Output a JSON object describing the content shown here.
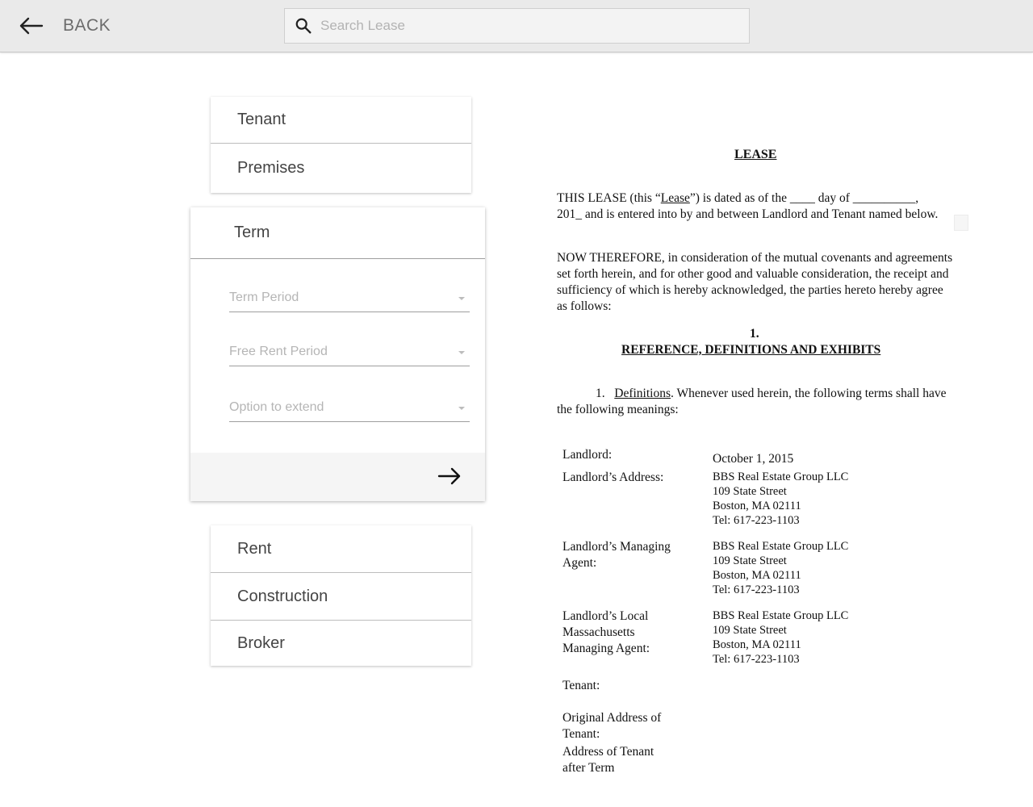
{
  "header": {
    "back_label": "BACK",
    "search_placeholder": "Search Lease"
  },
  "sidebar": {
    "top_items": [
      {
        "label": "Tenant"
      },
      {
        "label": "Premises"
      }
    ],
    "term": {
      "label": "Term",
      "fields": [
        {
          "placeholder": "Term Period"
        },
        {
          "placeholder": "Free Rent Period"
        },
        {
          "placeholder": "Option to extend"
        }
      ]
    },
    "bottom_items": [
      {
        "label": "Rent"
      },
      {
        "label": "Construction"
      },
      {
        "label": "Broker"
      }
    ]
  },
  "document": {
    "title": "LEASE",
    "intro_a": "THIS LEASE (this “",
    "intro_lease": "Lease",
    "intro_b": "”) is dated as of the ____ day of __________,",
    "intro_c": "201_ and is entered into by and between Landlord and Tenant named below.",
    "whereas": "NOW THEREFORE, in consideration of the mutual covenants and agreements set forth herein, and for other good and valuable consideration, the receipt and sufficiency of which is hereby acknowledged, the parties hereto hereby agree as follows:",
    "section_number": "1.",
    "section_title": "REFERENCE, DEFINITIONS AND EXHIBITS",
    "def_number": "1.",
    "def_term": "Definitions",
    "def_text": ".  Whenever used herein, the following terms shall have the following meanings:",
    "definitions": [
      {
        "label": "Landlord:",
        "value": [
          "October 1, 2015"
        ]
      },
      {
        "label": "Landlord’s Address:",
        "value": [
          "BBS Real Estate Group LLC",
          "109 State Street",
          "Boston, MA 02111",
          "Tel: 617-223-1103"
        ]
      },
      {
        "label": "Landlord’s Managing Agent:",
        "value": [
          "BBS Real Estate Group LLC",
          "109 State Street",
          "Boston, MA 02111",
          "Tel: 617-223-1103"
        ]
      },
      {
        "label": "Landlord’s Local Massachusetts Managing Agent:",
        "value": [
          "BBS Real Estate Group LLC",
          "109 State Street",
          "Boston, MA 02111",
          "Tel: 617-223-1103"
        ]
      },
      {
        "label": "Tenant:",
        "value": []
      },
      {
        "label": "Original Address of Tenant:",
        "value": []
      },
      {
        "label": "Address of Tenant after Term",
        "value": []
      }
    ]
  }
}
